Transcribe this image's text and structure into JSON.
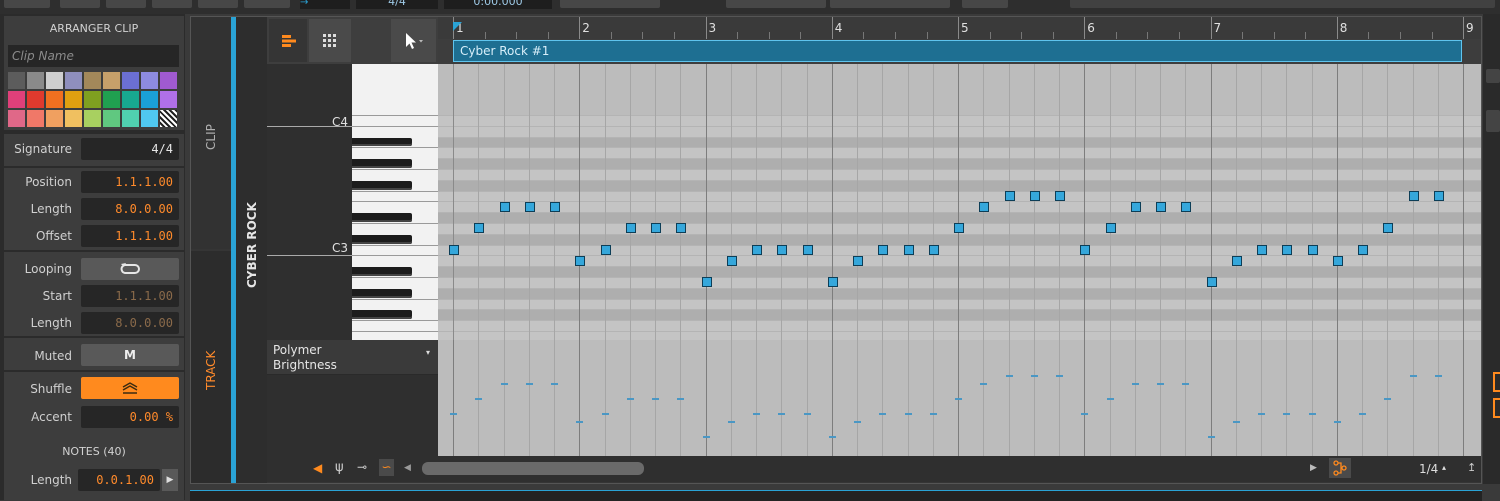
{
  "inspector": {
    "arranger_header": "ARRANGER CLIP",
    "clip_name_placeholder": "Clip Name",
    "palette": [
      "#5c5c5c",
      "#8a8a8a",
      "#cfcfcf",
      "#8f8fbd",
      "#a3885a",
      "#c6a06a",
      "#6b6fd3",
      "#8d8be0",
      "#a05ad0",
      "#e0407a",
      "#e03a2e",
      "#f07020",
      "#e0a010",
      "#7fa020",
      "#20a050",
      "#18a890",
      "#1aa0d8",
      "#b070e8",
      "#e06888",
      "#f07868",
      "#f0a060",
      "#f0c060",
      "#a8d060",
      "#60c880",
      "#50d0b0",
      "#50c8f0",
      "stripe"
    ],
    "signature_label": "Signature",
    "signature_value": "4/4",
    "position_label": "Position",
    "position_value": "1.1.1.00",
    "length_label": "Length",
    "length_value": "8.0.0.00",
    "offset_label": "Offset",
    "offset_value": "1.1.1.00",
    "looping_label": "Looping",
    "start_label": "Start",
    "start_value": "1.1.1.00",
    "loop_length_label": "Length",
    "loop_length_value": "8.0.0.00",
    "muted_label": "Muted",
    "muted_button": "M",
    "shuffle_label": "Shuffle",
    "accent_label": "Accent",
    "accent_value": "0.00 %",
    "notes_header": "NOTES (40)",
    "note_length_label": "Length",
    "note_length_value": "0.0.1.00"
  },
  "topbar": {
    "signature": "4/4",
    "time": "0:00.000"
  },
  "tabs": {
    "clip": "CLIP",
    "track": "TRACK"
  },
  "track_name": "CYBER ROCK",
  "clip": {
    "name": "Cyber Rock #1"
  },
  "ruler": {
    "bars": [
      "1",
      "2",
      "3",
      "4",
      "5",
      "6",
      "7",
      "8",
      "9"
    ]
  },
  "piano": {
    "labels": [
      "C4",
      "C3"
    ]
  },
  "automation": {
    "device": "Polymer",
    "parameter": "Brightness"
  },
  "bottombar": {
    "grid": "1/4"
  },
  "notes": [
    {
      "beat": 0,
      "pitch": 48
    },
    {
      "beat": 1,
      "pitch": 50
    },
    {
      "beat": 2,
      "pitch": 52
    },
    {
      "beat": 3,
      "pitch": 52
    },
    {
      "beat": 4,
      "pitch": 52
    },
    {
      "beat": 5,
      "pitch": 47
    },
    {
      "beat": 6,
      "pitch": 48
    },
    {
      "beat": 7,
      "pitch": 50
    },
    {
      "beat": 8,
      "pitch": 50
    },
    {
      "beat": 9,
      "pitch": 50
    },
    {
      "beat": 10,
      "pitch": 45
    },
    {
      "beat": 11,
      "pitch": 47
    },
    {
      "beat": 12,
      "pitch": 48
    },
    {
      "beat": 13,
      "pitch": 48
    },
    {
      "beat": 14,
      "pitch": 48
    },
    {
      "beat": 15,
      "pitch": 45
    },
    {
      "beat": 16,
      "pitch": 47
    },
    {
      "beat": 17,
      "pitch": 48
    },
    {
      "beat": 18,
      "pitch": 48
    },
    {
      "beat": 19,
      "pitch": 48
    },
    {
      "beat": 20,
      "pitch": 50
    },
    {
      "beat": 21,
      "pitch": 52
    },
    {
      "beat": 22,
      "pitch": 53
    },
    {
      "beat": 23,
      "pitch": 53
    },
    {
      "beat": 24,
      "pitch": 53
    },
    {
      "beat": 25,
      "pitch": 48
    },
    {
      "beat": 26,
      "pitch": 50
    },
    {
      "beat": 27,
      "pitch": 52
    },
    {
      "beat": 28,
      "pitch": 52
    },
    {
      "beat": 29,
      "pitch": 52
    },
    {
      "beat": 30,
      "pitch": 45
    },
    {
      "beat": 31,
      "pitch": 47
    },
    {
      "beat": 32,
      "pitch": 48
    },
    {
      "beat": 33,
      "pitch": 48
    },
    {
      "beat": 34,
      "pitch": 48
    },
    {
      "beat": 35,
      "pitch": 47
    },
    {
      "beat": 36,
      "pitch": 48
    },
    {
      "beat": 37,
      "pitch": 50
    },
    {
      "beat": 38,
      "pitch": 53
    },
    {
      "beat": 39,
      "pitch": 53
    }
  ]
}
